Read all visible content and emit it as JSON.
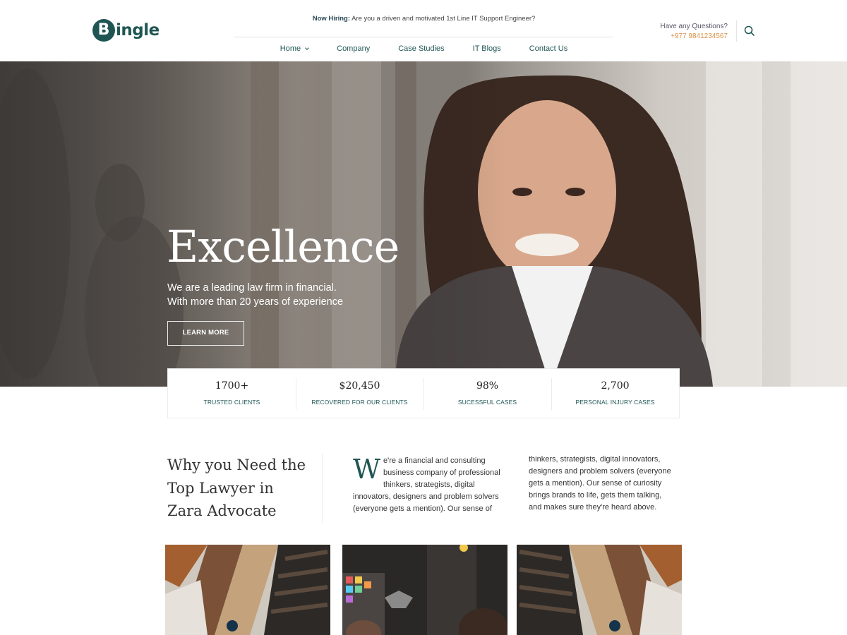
{
  "brand": {
    "logo_letter": "B",
    "logo_text": "ingle",
    "color": "#1f5654"
  },
  "announcement": {
    "label": "Now Hiring:",
    "text": " Are you a driven and motivated 1st Line IT Support Engineer?"
  },
  "nav": {
    "items": [
      {
        "label": "Home",
        "has_dropdown": true
      },
      {
        "label": "Company"
      },
      {
        "label": "Case Studies"
      },
      {
        "label": "IT Blogs"
      },
      {
        "label": "Contact Us"
      }
    ]
  },
  "contact": {
    "question": "Have any Questions?",
    "phone": "+977 9841234567",
    "phone_color": "#d8924a"
  },
  "search": {
    "icon": "search-icon"
  },
  "hero": {
    "title": "Excellence",
    "subtitle_line1": "We are a leading law firm in financial.",
    "subtitle_line2": "With more than 20 years of experience",
    "button": "LEARN MORE"
  },
  "stats": [
    {
      "value": "1700+",
      "label": "TRUSTED CLIENTS"
    },
    {
      "value": "$20,450",
      "label": "RECOVERED FOR OUR CLIENTS"
    },
    {
      "value": "98%",
      "label": "SUCESSFUL CASES"
    },
    {
      "value": "2,700",
      "label": "PERSONAL INJURY CASES"
    }
  ],
  "why": {
    "title_line1": "Why you Need the",
    "title_line2": "Top Lawyer in",
    "title_line3": "Zara Advocate",
    "dropcap": "W",
    "col1_lines": [
      "e're a financial and consulting",
      "business company of professional",
      "thinkers, strategists, digital",
      "innovators, designers and problem solvers",
      "(everyone gets a mention). Our sense of"
    ],
    "col2_lines": [
      "thinkers, strategists, digital innovators,",
      "designers and problem solvers (everyone",
      "gets a mention). Our sense of curiosity",
      "brings brands to life, gets them talking,",
      "and makes sure they're heard above."
    ]
  }
}
